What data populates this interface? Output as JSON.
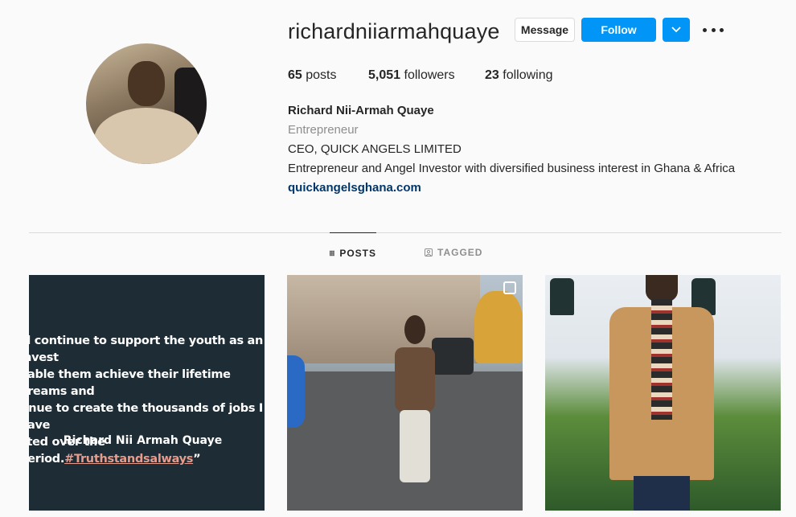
{
  "profile": {
    "username": "richardniiarmahquaye",
    "buttons": {
      "message": "Message",
      "follow": "Follow"
    },
    "stats": {
      "posts_count": "65",
      "posts_label": "posts",
      "followers_count": "5,051",
      "followers_label": "followers",
      "following_count": "23",
      "following_label": "following"
    },
    "bio": {
      "name": "Richard Nii-Armah Quaye",
      "category": "Entrepreneur",
      "line1": "CEO, QUICK ANGELS LIMITED",
      "line2": "Entrepreneur and Angel Investor with diversified business interest in Ghana & Africa",
      "link": "quickangelsghana.com"
    }
  },
  "tabs": {
    "posts": "POSTS",
    "tagged": "TAGGED"
  },
  "posts": {
    "quote_lines": [
      "ill continue to support the youth as an Invest",
      "nable them achieve their lifetime dreams and",
      "tinue to create the thousands of jobs I have"
    ],
    "quote_last_prefix": "ated over the period.",
    "quote_hashtag": "#Truthstandsalways",
    "quote_last_suffix": "”",
    "signature": "Richard Nii Armah Quaye"
  },
  "icons": {
    "dropdown": "chevron-down-icon",
    "more": "more-horizontal-icon",
    "posts_tab": "grid-icon",
    "tagged_tab": "tag-user-icon",
    "multi": "multiple-posts-icon"
  },
  "colors": {
    "accent": "#0095f6",
    "link": "#00376b",
    "muted": "#8e8e8e"
  }
}
